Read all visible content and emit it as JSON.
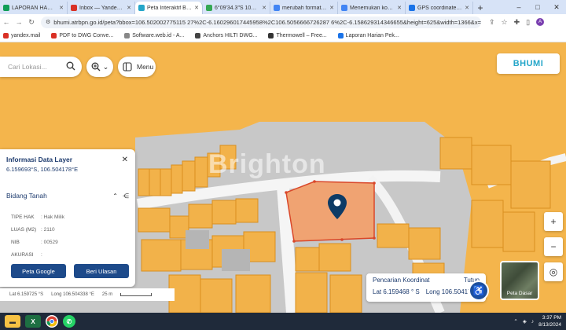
{
  "browser": {
    "tabs": [
      {
        "label": "LAPORAN HARIAN",
        "color": "#0f9d58"
      },
      {
        "label": "Inbox — Yandex Mail",
        "color": "#d93025"
      },
      {
        "label": "Peta Interaktif BHUMI",
        "color": "#24a6c9",
        "active": true
      },
      {
        "label": "6°09'34.3\"S 106°3...",
        "color": "#34a853"
      },
      {
        "label": "merubah format ko...",
        "color": "#4285f4"
      },
      {
        "label": "Menemukan koordin...",
        "color": "#4285f4"
      },
      {
        "label": "GPS coordinate con...",
        "color": "#1a73e8"
      }
    ],
    "new_tab": "+",
    "window_controls": [
      "–",
      "□",
      "✕"
    ],
    "url": "bhumi.atrbpn.go.id/peta?bbox=106.502002775115 27%2C-6.160296017445958%2C106.5056666726287 6%2C-6.158629314346655&height=625&width=1366&x=...",
    "bookmarks": [
      {
        "label": "yandex.mail",
        "color": "#d93025"
      },
      {
        "label": "PDF to DWG Conve...",
        "color": "#d93025"
      },
      {
        "label": "Software.web.id - A...",
        "color": "#888888"
      },
      {
        "label": "Anchors HILTI DWG...",
        "color": "#444444"
      },
      {
        "label": "Thermowell – Free...",
        "color": "#333333"
      },
      {
        "label": "Laporan Harian Pek...",
        "color": "#1a73e8"
      }
    ]
  },
  "map": {
    "search_placeholder": "Cari Lokasi...",
    "menu_label": "Menu",
    "brand": "BHUMI",
    "watermark": "Brighton"
  },
  "info_panel": {
    "title": "Informasi Data Layer",
    "coords": "6.159693°S, 106.504178°E",
    "section": "Bidang Tanah",
    "rows": [
      {
        "key": "TIPE HAK",
        "value": ": Hak Milik"
      },
      {
        "key": "LUAS (M2)",
        "value": ": 2110"
      },
      {
        "key": "NIB",
        "value": ": 00529"
      },
      {
        "key": "AKURASI",
        "value": ":"
      }
    ],
    "btn_google": "Peta Google",
    "btn_review": "Beri Ulasan"
  },
  "scale": {
    "lat": "Lat  6.159725 °S",
    "lng": "Long  106.504338 °E",
    "distance": "25 m"
  },
  "coord_search": {
    "title": "Pencarian Koordinat",
    "close": "Tutup",
    "lat_label": "Lat",
    "lat_value": "6.159468 ° S",
    "lng_label": "Long",
    "lng_value": "106.50417..."
  },
  "basemap_label": "Peta Dasar",
  "taskbar": {
    "time": "3:37 PM",
    "date": "8/13/2024"
  }
}
